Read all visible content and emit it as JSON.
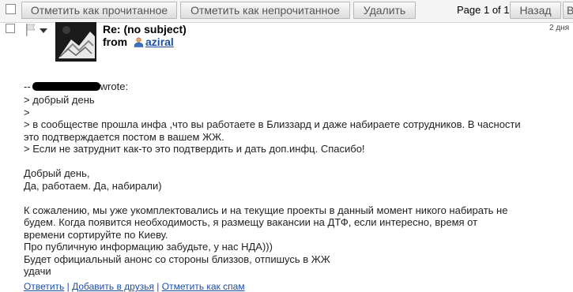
{
  "toolbar": {
    "mark_read": "Отметить как прочитанное",
    "mark_unread": "Отметить как непрочитанное",
    "delete": "Удалить",
    "page_info": "Page 1 of 1",
    "back": "Назад",
    "next": "В"
  },
  "message": {
    "subject": "Re: (no subject)",
    "from_label": "from",
    "username": "aziral",
    "date": "2 дня"
  },
  "body": {
    "quote_head_suffix": "wrote:",
    "lines": [
      "> добрый день",
      ">",
      "> в сообществе прошла инфа ,что вы работаете в Близзард и даже набираете сотрудников. В часности",
      "это подтверждается постом в вашем ЖЖ.",
      "> Если не затруднит как-то это подтвердить и дать доп.инфц. Спасибо!",
      "",
      "Добрый день,",
      "Да, работаем. Да, набирали)",
      "",
      "К сожалению, мы уже укомплектовались и на текущие проекты в данный момент никого набирать не",
      "будем. Когда появится необходимость, я размещу вакансии на ДТФ, если интересно, время от",
      "времени сортируйте по Киеву.",
      "Про публичную информацию забудьте, у нас НДА)))",
      "Будет официальный анонс со стороны близзов, отпишусь в ЖЖ",
      "удачи"
    ]
  },
  "footer": {
    "reply": "Ответить",
    "add_friend": "Добавить в друзья",
    "mark_spam": "Отметить как спам",
    "separator": " | "
  }
}
